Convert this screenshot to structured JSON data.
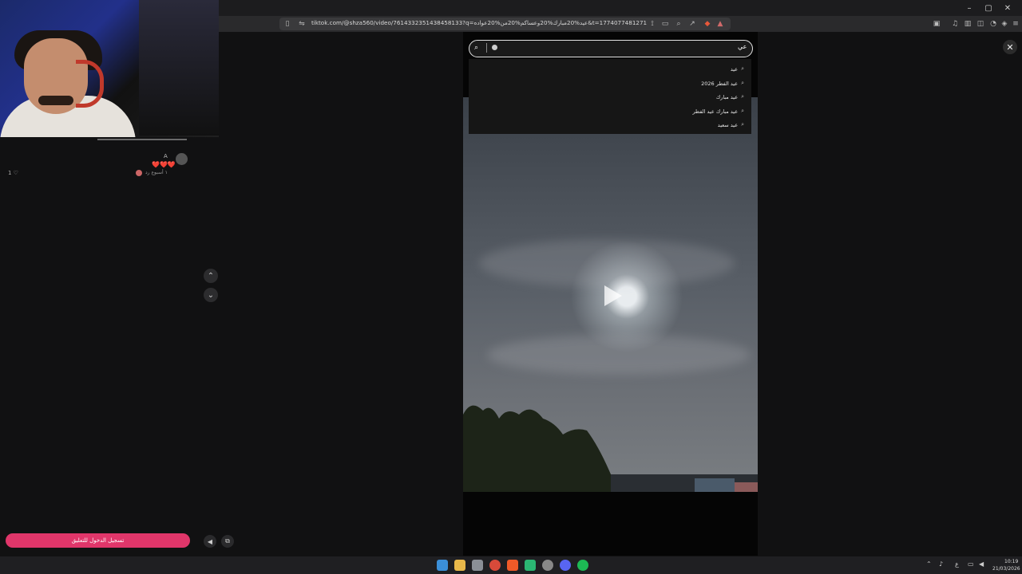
{
  "browser": {
    "url": "tiktok.com/@shza560/video/7614332351438458133?q=عيد%20مبارك%20وعساكم%20من%20عواده&t=1774077481271",
    "window_controls": [
      "–",
      "▢",
      "✕"
    ]
  },
  "comment": {
    "username": "A",
    "text": "❤️❤️❤️",
    "meta": "١ أسبوع رد",
    "likes": "1 ♡"
  },
  "login_button": "تسجيل الدخول للتعليق",
  "search": {
    "value": "عي",
    "suggestions": [
      "عيد",
      "عيد الفطر 2026",
      "عيد مبارك",
      "عيد مبارك عيد الفطر",
      "عيد سعيد"
    ]
  },
  "taskbar": {
    "time": "10:19",
    "date": "21/03/2026",
    "lang": "ع"
  },
  "colors": {
    "accent": "#e0366a",
    "background": "#111112"
  }
}
